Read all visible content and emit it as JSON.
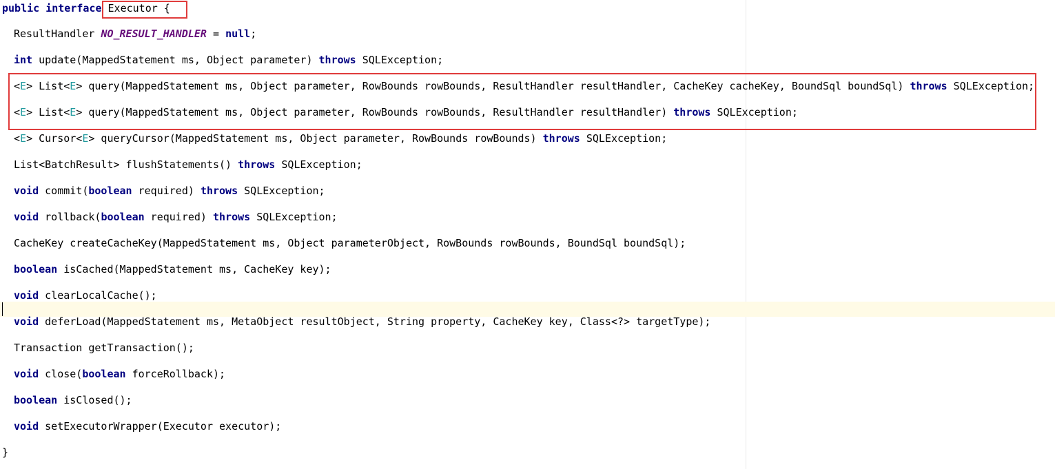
{
  "code": {
    "l1": {
      "kw_public": "public",
      "kw_interface": "interface",
      "name": "Executor",
      "brace": " {"
    },
    "l2": {
      "type": "ResultHandler ",
      "const": "NO_RESULT_HANDLER",
      "eq": " = ",
      "kw_null": "null",
      "end": ";"
    },
    "l3": {
      "kw_int": "int",
      "rest": " update(MappedStatement ms, Object parameter) ",
      "kw_throws": "throws",
      "exc": " SQLException;"
    },
    "l4": {
      "lt": "<",
      "e1": "E",
      "gt_list": "> List<",
      "e2": "E",
      "rest": "> query(MappedStatement ms, Object parameter, RowBounds rowBounds, ResultHandler resultHandler, CacheKey cacheKey, BoundSql boundSql) ",
      "kw_throws": "throws",
      "exc": " SQLException;"
    },
    "l5": {
      "lt": "<",
      "e1": "E",
      "gt_list": "> List<",
      "e2": "E",
      "rest": "> query(MappedStatement ms, Object parameter, RowBounds rowBounds, ResultHandler resultHandler) ",
      "kw_throws": "throws",
      "exc": " SQLException;"
    },
    "l6": {
      "lt": "<",
      "e1": "E",
      "gt_cursor": "> Cursor<",
      "e2": "E",
      "rest": "> queryCursor(MappedStatement ms, Object parameter, RowBounds rowBounds) ",
      "kw_throws": "throws",
      "exc": " SQLException;"
    },
    "l7": {
      "rest": "List<BatchResult> flushStatements() ",
      "kw_throws": "throws",
      "exc": " SQLException;"
    },
    "l8": {
      "kw_void": "void",
      "a": " commit(",
      "kw_boolean": "boolean",
      "b": " required) ",
      "kw_throws": "throws",
      "exc": " SQLException;"
    },
    "l9": {
      "kw_void": "void",
      "a": " rollback(",
      "kw_boolean": "boolean",
      "b": " required) ",
      "kw_throws": "throws",
      "exc": " SQLException;"
    },
    "l10": {
      "rest": "CacheKey createCacheKey(MappedStatement ms, Object parameterObject, RowBounds rowBounds, BoundSql boundSql);"
    },
    "l11": {
      "kw_boolean": "boolean",
      "rest": " isCached(MappedStatement ms, CacheKey key);"
    },
    "l12": {
      "kw_void": "void",
      "rest": " clearLocalCache();"
    },
    "l13": {
      "kw_void": "void",
      "rest": " deferLoad(MappedStatement ms, MetaObject resultObject, String property, CacheKey key, Class<?> targetType);"
    },
    "l14": {
      "rest": "Transaction getTransaction();"
    },
    "l15": {
      "kw_void": "void",
      "a": " close(",
      "kw_boolean": "boolean",
      "b": " forceRollback);"
    },
    "l16": {
      "kw_boolean": "boolean",
      "rest": " isClosed();"
    },
    "l17": {
      "kw_void": "void",
      "rest": " setExecutorWrapper(Executor executor);"
    },
    "l18": {
      "brace": "}"
    }
  },
  "colors": {
    "keyword": "#000080",
    "constant": "#660e7a",
    "type_param": "#20999d",
    "highlight_box": "#e03c3c",
    "current_line": "#fffbe6"
  }
}
